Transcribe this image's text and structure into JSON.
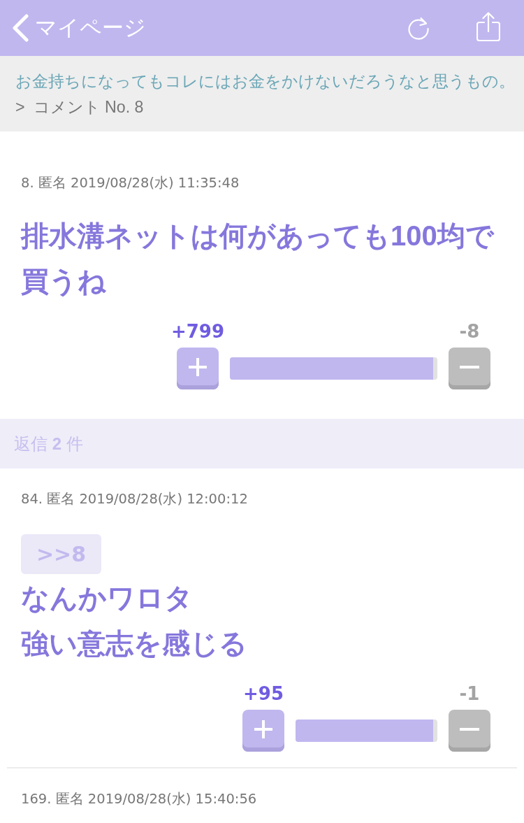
{
  "header": {
    "back_label": "マイページ"
  },
  "breadcrumb": {
    "thread_title": "お金持ちになってもコレにはお金をかけないだろうなと思うもの。",
    "separator": ">",
    "current": "コメント No. 8"
  },
  "comment": {
    "meta": "8. 匿名 2019/08/28(水) 11:35:48",
    "body": "排水溝ネットは何があっても100均で買うね",
    "votes": {
      "plus": "+799",
      "minus": "-8",
      "level": 0.98
    }
  },
  "replies_header": "返信 **2** 件",
  "replies": [
    {
      "meta": "84. 匿名 2019/08/28(水) 12:00:12",
      "anchor": ">>8",
      "body_lines": [
        "なんかワロタ",
        "強い意志を感じる"
      ],
      "votes": {
        "plus": "+95",
        "minus": "-1",
        "level": 0.97
      }
    },
    {
      "meta": "169. 匿名 2019/08/28(水) 15:40:56"
    }
  ]
}
